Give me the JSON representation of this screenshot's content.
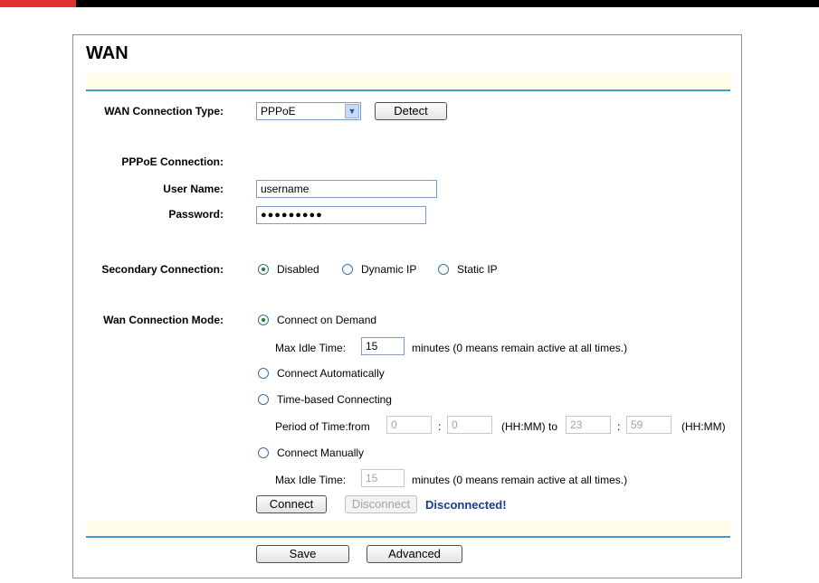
{
  "page": {
    "title": "WAN"
  },
  "connection_type": {
    "label": "WAN Connection Type:",
    "value": "PPPoE",
    "detect_label": "Detect"
  },
  "pppoe": {
    "section_label": "PPPoE Connection:",
    "username_label": "User Name:",
    "username_value": "username",
    "password_label": "Password:",
    "password_value": "●●●●●●●●●"
  },
  "secondary": {
    "label": "Secondary Connection:",
    "options": [
      "Disabled",
      "Dynamic IP",
      "Static IP"
    ],
    "selected": "Disabled"
  },
  "mode": {
    "label": "Wan Connection Mode:",
    "selected": "Connect on Demand",
    "on_demand": {
      "label": "Connect on Demand",
      "idle_label": "Max Idle Time:",
      "idle_value": "15",
      "idle_suffix": "minutes (0 means remain active at all times.)"
    },
    "automatic": {
      "label": "Connect Automatically"
    },
    "time_based": {
      "label": "Time-based Connecting",
      "period_label": "Period of Time:from",
      "from_hh": "0",
      "from_mm": "0",
      "to_label": "(HH:MM) to",
      "to_hh": "23",
      "to_mm": "59",
      "suffix": "(HH:MM)",
      "separator": ":"
    },
    "manual": {
      "label": "Connect Manually",
      "idle_label": "Max Idle Time:",
      "idle_value": "15",
      "idle_suffix": "minutes (0 means remain active at all times.)"
    }
  },
  "actions": {
    "connect_label": "Connect",
    "disconnect_label": "Disconnect",
    "status": "Disconnected!",
    "save_label": "Save",
    "advanced_label": "Advanced"
  },
  "colors": {
    "accent_rule": "#3b9ccf",
    "band": "#fffde8",
    "status_text": "#1a3a8f",
    "header_red": "#e0312f"
  }
}
